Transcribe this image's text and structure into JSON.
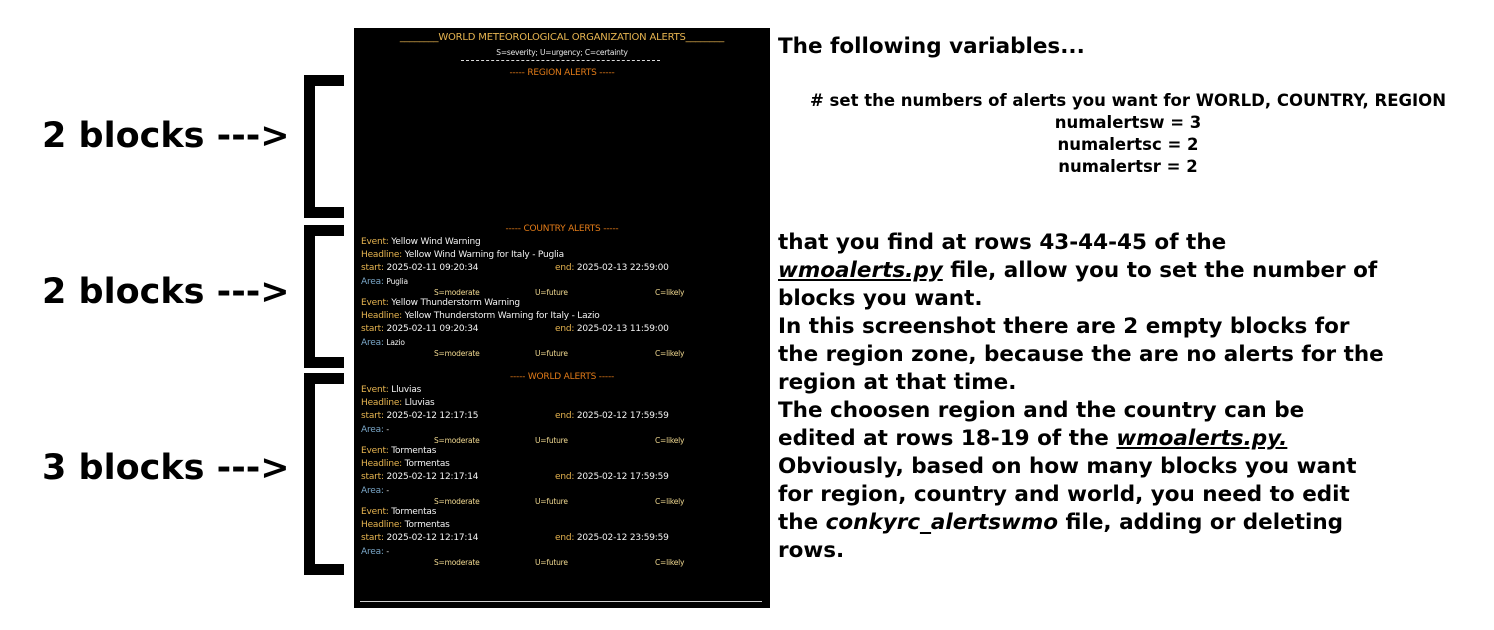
{
  "left": {
    "labels": [
      "2 blocks --->",
      "2 blocks --->",
      "3 blocks --->"
    ]
  },
  "conky": {
    "title": "________WORLD METEOROLOGICAL ORGANIZATION ALERTS________",
    "subtitle": "S=severity; U=urgency; C=certainty",
    "region_header": "----- REGION ALERTS -----",
    "country_header": "----- COUNTRY ALERTS -----",
    "world_header": "----- WORLD ALERTS -----",
    "field_labels": {
      "event": "Event:",
      "headline": "Headline:",
      "start": "start:",
      "end": "end:",
      "area": "Area:"
    },
    "country_alerts": [
      {
        "event": "Yellow Wind Warning",
        "headline": "Yellow Wind Warning for Italy - Puglia",
        "start": "2025-02-11 09:20:34",
        "end": "2025-02-13 22:59:00",
        "area": "Puglia",
        "s": "S=moderate",
        "u": "U=future",
        "c": "C=likely"
      },
      {
        "event": "Yellow Thunderstorm Warning",
        "headline": "Yellow Thunderstorm Warning for Italy - Lazio",
        "start": "2025-02-11 09:20:34",
        "end": "2025-02-13 11:59:00",
        "area": "Lazio",
        "s": "S=moderate",
        "u": "U=future",
        "c": "C=likely"
      }
    ],
    "world_alerts": [
      {
        "event": "Lluvias",
        "headline": "Lluvias",
        "start": "2025-02-12 12:17:15",
        "end": "2025-02-12 17:59:59",
        "area": "-",
        "s": "S=moderate",
        "u": "U=future",
        "c": "C=likely"
      },
      {
        "event": "Tormentas",
        "headline": "Tormentas",
        "start": "2025-02-12 12:17:14",
        "end": "2025-02-12 17:59:59",
        "area": "-",
        "s": "S=moderate",
        "u": "U=future",
        "c": "C=likely"
      },
      {
        "event": "Tormentas",
        "headline": "Tormentas",
        "start": "2025-02-12 12:17:14",
        "end": "2025-02-12 23:59:59",
        "area": "-",
        "s": "S=moderate",
        "u": "U=future",
        "c": "C=likely"
      }
    ]
  },
  "right": {
    "intro": "The following variables...",
    "code": [
      "# set the numbers of alerts you want for WORLD, COUNTRY, REGION",
      "numalertsw = 3",
      "numalertsc = 2",
      "numalertsr = 2"
    ],
    "p1": "that you find at rows 43-44-45 of the",
    "file1": "wmoalerts.py",
    "p2": " file, allow you to set the number of",
    "p3": "blocks you want.",
    "p4": "In this screenshot there are 2 empty blocks for",
    "p5": "the region zone, because the are no alerts for the",
    "p6": "region at that time.",
    "p7": "The choosen region and the country can be",
    "p8": "edited at rows 18-19 of the ",
    "file2": "wmoalerts.py.",
    "p9": "Obviously, based on how many blocks you want",
    "p10": "for region, country and world, you need to edit",
    "p11a": "the ",
    "file3": "conkyrc_alertswmo",
    "p11b": " file, adding or deleting",
    "p12": "rows."
  }
}
